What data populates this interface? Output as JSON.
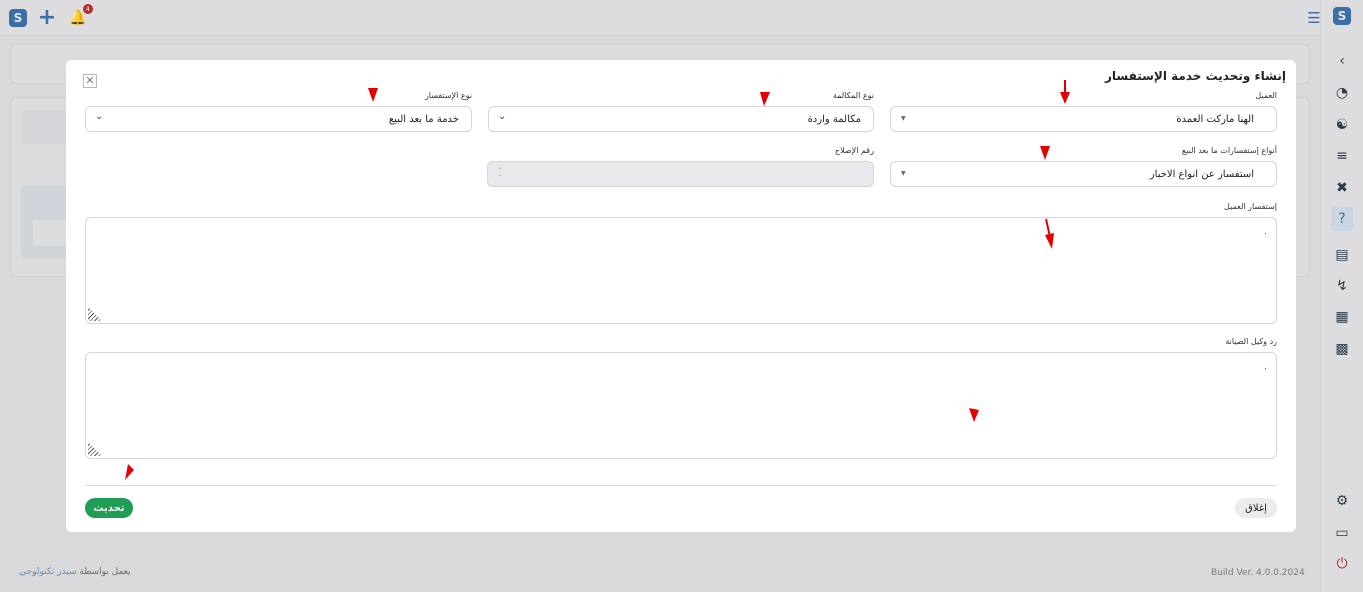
{
  "topbar": {
    "logo_icon": "app-logo-icon",
    "add_icon": "plus-icon",
    "notification_icon": "bell-icon",
    "notification_count": "4",
    "menu_icon": "hamburger-icon"
  },
  "sidebar": {
    "icons": [
      "chevron-left-icon",
      "dashboard-icon",
      "users-icon",
      "list-icon",
      "tools-icon",
      "question-icon",
      "document-icon",
      "route-icon",
      "hierarchy-icon",
      "bar-chart-icon",
      "settings-icon",
      "window-icon",
      "power-icon"
    ],
    "active_index": 5
  },
  "footer": {
    "powered_by": "يعمل بواسطة",
    "brand": "سيدر تكنولوجي",
    "build": "Build Ver. 4.0.0.2024"
  },
  "modal": {
    "title": "إنشاء وتحديث خدمة الإستفسار",
    "fields": {
      "customer_label": "العميل",
      "customer_value": "الهنا ماركت العمدة",
      "call_type_label": "نوع المكالمة",
      "call_type_value": "مكالمة واردة",
      "inquiry_type_label": "نوع الإستفسار",
      "inquiry_type_value": "خدمة ما بعد البيع",
      "after_sales_types_label": "أنواع إستفسارات ما بعد البيع",
      "after_sales_types_value": "استفسار عن انواع الاحبار",
      "repair_number_label": "رقم الإصلاح",
      "repair_number_value": "",
      "customer_inquiry_label": "إستفسار العميل",
      "customer_inquiry_value": ".",
      "agent_reply_label": "رد وكيل الصيانة",
      "agent_reply_value": "."
    },
    "buttons": {
      "update": "تحديث",
      "close": "إغلاق"
    }
  },
  "colors": {
    "primary": "#3d6fa7",
    "success": "#1f9d55",
    "annotation_arrow": "#e30000"
  }
}
